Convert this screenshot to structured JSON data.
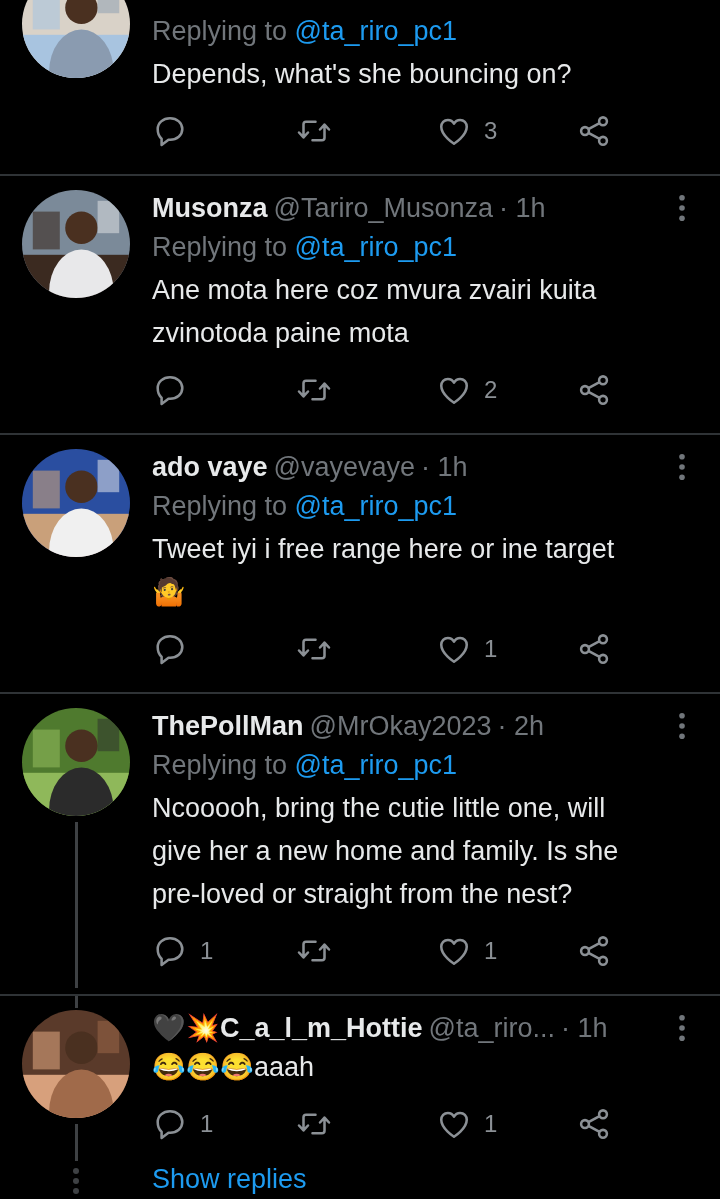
{
  "tweets": [
    {
      "replying_to": "Replying to ",
      "mention": "@ta_riro_pc1",
      "text": "Depends, what's she bouncing on?",
      "like_count": "3",
      "thread_below": false
    },
    {
      "name": "Musonza",
      "handle": "@Tariro_Musonza",
      "time": "· 1h",
      "replying_to": "Replying to ",
      "mention": "@ta_riro_pc1",
      "text": "Ane mota here coz mvura zvairi kuita zvinotoda paine mota",
      "like_count": "2",
      "thread_below": false
    },
    {
      "name": "ado vaye",
      "handle": "@vayevaye",
      "time": "· 1h",
      "replying_to": "Replying to ",
      "mention": "@ta_riro_pc1",
      "text": "Tweet iyi i free range here or ine target🤷",
      "like_count": "1",
      "thread_below": false
    },
    {
      "name": "ThePollMan",
      "handle": "@MrOkay2023",
      "time": "· 2h",
      "replying_to": "Replying to ",
      "mention": "@ta_riro_pc1",
      "text": "Ncooooh, bring the cutie little one, will give her a new home and family. Is she pre-loved or straight from the nest?",
      "reply_count": "1",
      "like_count": "1",
      "thread_below": true
    },
    {
      "name": "🖤💥C_a_l_m_Hottie",
      "handle": "@ta_riro...",
      "time": "· 1h",
      "text": "😂😂😂aaah",
      "reply_count": "1",
      "like_count": "1",
      "thread_below": true,
      "show_replies": "Show replies"
    }
  ]
}
